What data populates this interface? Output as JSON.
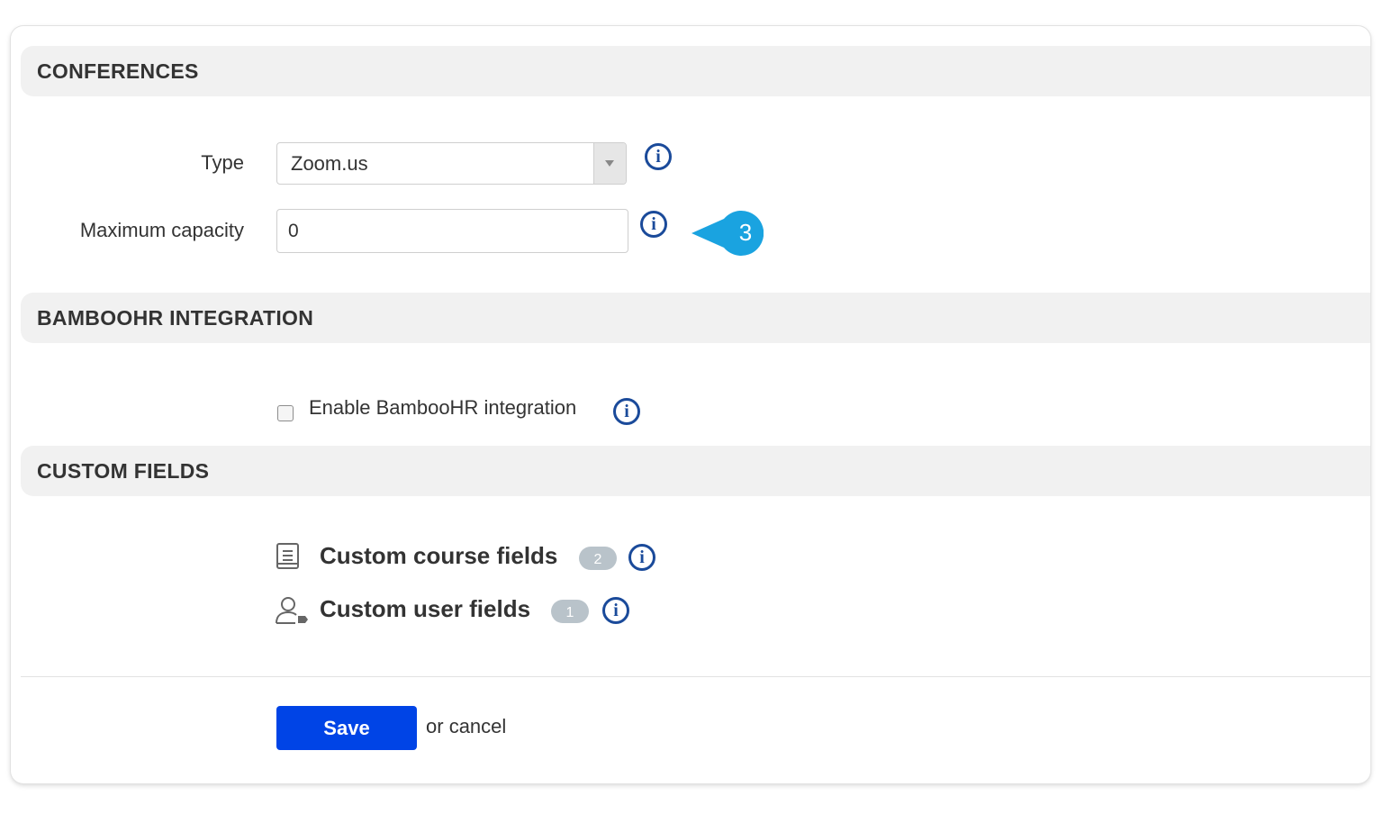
{
  "sections": {
    "conferences": {
      "title": "CONFERENCES"
    },
    "bamboohr": {
      "title": "BAMBOOHR INTEGRATION"
    },
    "custom_fields": {
      "title": "CUSTOM FIELDS"
    }
  },
  "conferences": {
    "type_label": "Type",
    "type_value": "Zoom.us",
    "capacity_label": "Maximum capacity",
    "capacity_value": "0"
  },
  "callout": {
    "number": "3",
    "color": "#1aa3e0"
  },
  "bamboohr": {
    "checkbox_label": "Enable BambooHR integration",
    "checked": false
  },
  "custom_fields": {
    "course": {
      "label": "Custom course fields",
      "count": "2",
      "icon": "document-icon"
    },
    "user": {
      "label": "Custom user fields",
      "count": "1",
      "icon": "user-tag-icon"
    }
  },
  "actions": {
    "save_label": "Save",
    "or_text": "or",
    "cancel_label": "cancel"
  },
  "colors": {
    "accent": "#0044e6",
    "info": "#1a4a9a",
    "badge": "#b9c3ca"
  }
}
